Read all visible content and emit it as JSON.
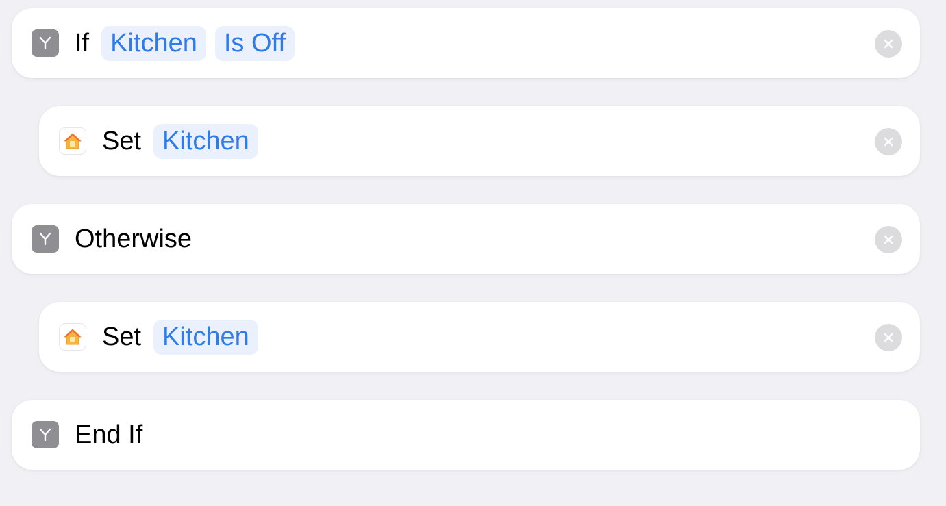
{
  "colors": {
    "background": "#F0F0F5",
    "card": "#FFFFFF",
    "token_text": "#2F7BEA",
    "token_background": "#EAF1FD",
    "script_icon": "#8E8E93",
    "remove_button": "#DCDCDE",
    "home_icon": "#F7B53B"
  },
  "actions": [
    {
      "icon": "scripting-branch-icon",
      "label": "If",
      "tokens": [
        "Kitchen",
        "Is Off"
      ],
      "removable": true
    },
    {
      "icon": "home-icon",
      "label": "Set",
      "tokens": [
        "Kitchen"
      ],
      "removable": true
    },
    {
      "icon": "scripting-branch-icon",
      "label": "Otherwise",
      "tokens": [],
      "removable": true
    },
    {
      "icon": "home-icon",
      "label": "Set",
      "tokens": [
        "Kitchen"
      ],
      "removable": true
    },
    {
      "icon": "scripting-branch-icon",
      "label": "End If",
      "tokens": [],
      "removable": false
    }
  ]
}
